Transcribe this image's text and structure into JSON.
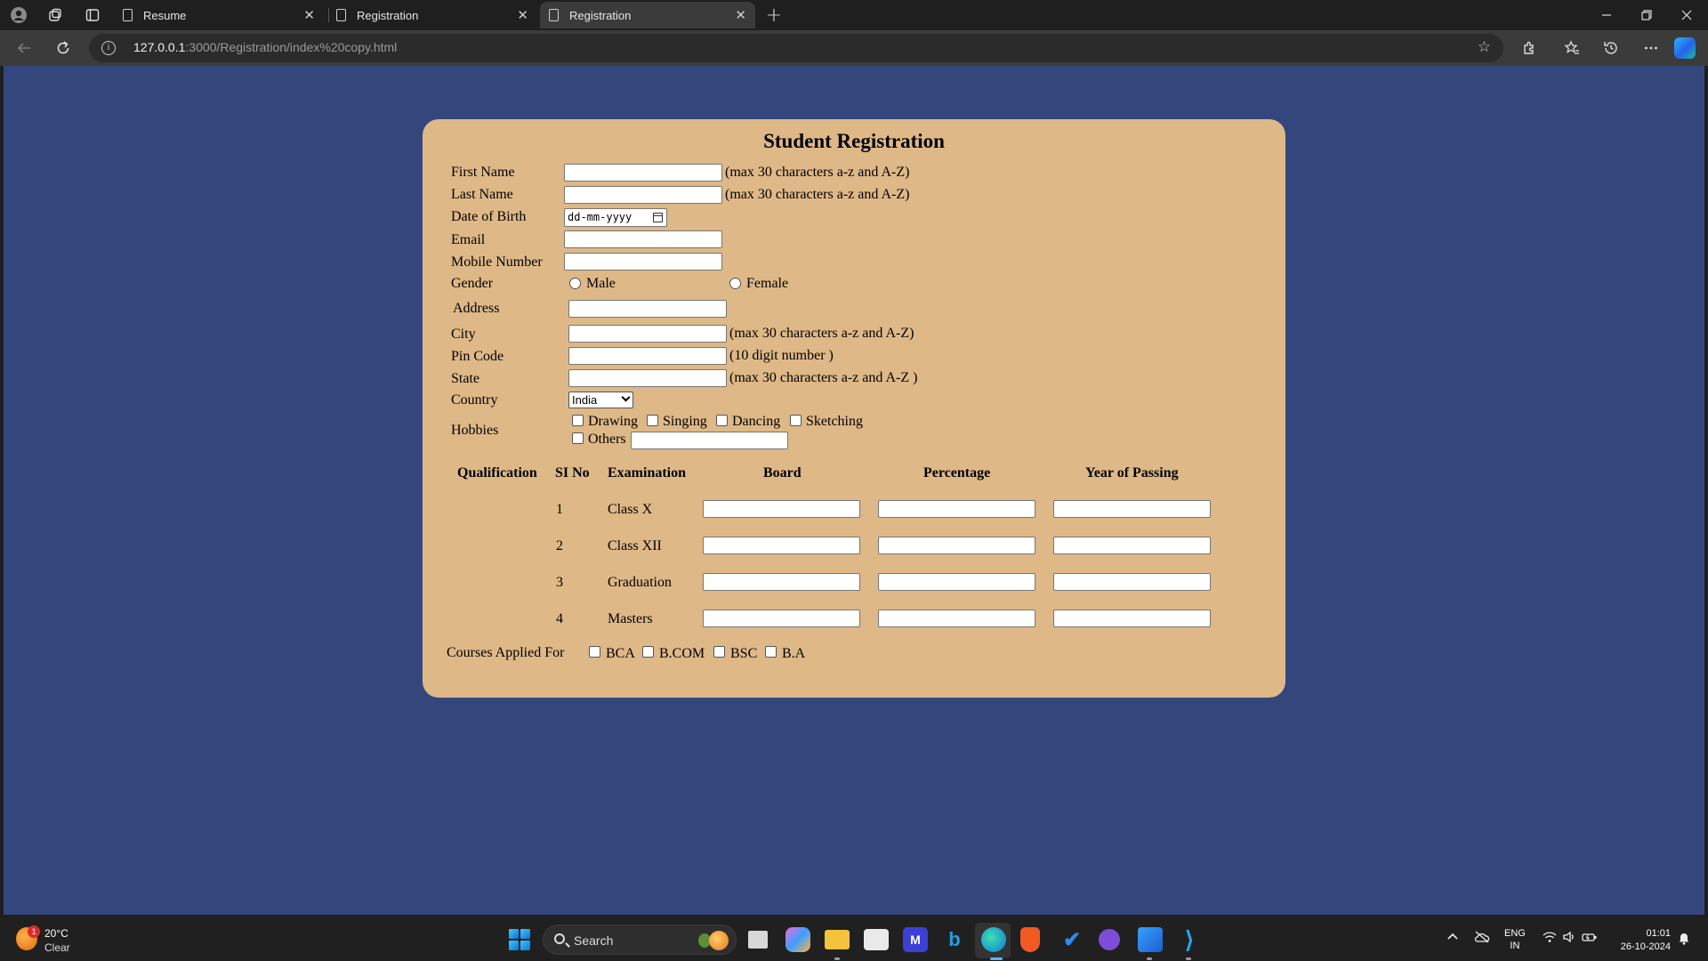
{
  "browser": {
    "tabs": [
      {
        "title": "Resume"
      },
      {
        "title": "Registration"
      },
      {
        "title": "Registration"
      }
    ],
    "new_tab_glyph": "+",
    "url_host": "127.0.0.1",
    "url_rest": ":3000/Registration/index%20copy.html"
  },
  "form": {
    "title": "Student Registration",
    "first_name_label": "First Name",
    "first_name_hint": "(max 30 characters a-z and A-Z)",
    "last_name_label": "Last Name",
    "last_name_hint": "(max 30 characters a-z and A-Z)",
    "dob_label": "Date of Birth",
    "dob_placeholder": "dd-mm-yyyy",
    "email_label": "Email",
    "mobile_label": "Mobile Number",
    "gender_label": "Gender",
    "gender_male": "Male",
    "gender_female": "Female",
    "address_label": "Address",
    "city_label": "City",
    "city_hint": "(max 30 characters a-z and A-Z)",
    "pin_label": "Pin Code",
    "pin_hint": "(10 digit number )",
    "state_label": "State",
    "state_hint": "(max 30 characters a-z and A-Z )",
    "country_label": "Country",
    "country_value": "India",
    "hobbies_label": "Hobbies",
    "hobbies": [
      "Drawing",
      "Singing",
      "Dancing",
      "Sketching",
      "Others"
    ],
    "qualification": {
      "label": "Qualification",
      "headers": [
        "SI No",
        "Examination",
        "Board",
        "Percentage",
        "Year of Passing"
      ],
      "rows": [
        {
          "no": "1",
          "exam": "Class X"
        },
        {
          "no": "2",
          "exam": "Class XII"
        },
        {
          "no": "3",
          "exam": "Graduation"
        },
        {
          "no": "4",
          "exam": "Masters"
        }
      ]
    },
    "courses_label": "Courses Applied For",
    "courses": [
      "BCA",
      "B.COM",
      "BSC",
      "B.A"
    ]
  },
  "taskbar": {
    "weather_temp": "20°C",
    "weather_cond": "Clear",
    "weather_badge": "1",
    "search_text": "Search",
    "lang_1": "ENG",
    "lang_2": "IN",
    "time": "01:01",
    "date": "26-10-2024"
  }
}
